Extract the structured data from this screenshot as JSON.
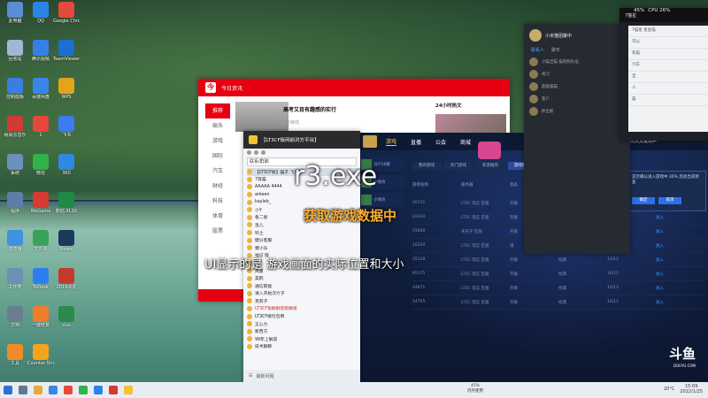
{
  "desktop": {
    "icons": [
      {
        "label": "此电脑",
        "color": "#5b8cd6"
      },
      {
        "label": "QQ",
        "color": "#2a84e8"
      },
      {
        "label": "Google Chrome",
        "color": "#e64a3c"
      },
      {
        "label": "回收站",
        "color": "#9fb7d8"
      },
      {
        "label": "腾讯视频",
        "color": "#3580e8"
      },
      {
        "label": "TeamViewer",
        "color": "#1c6fd1"
      },
      {
        "label": "控制面板",
        "color": "#3b7de0"
      },
      {
        "label": "百度网盘",
        "color": "#3a86e8"
      },
      {
        "label": "WPS",
        "color": "#e5a319"
      },
      {
        "label": "网易云音乐",
        "color": "#d33a31"
      },
      {
        "label": "1",
        "color": "#e8463a"
      },
      {
        "label": "飞书",
        "color": "#3c7bf0"
      },
      {
        "label": "系统",
        "color": "#6c90bc"
      },
      {
        "label": "微信",
        "color": "#2fb34a"
      },
      {
        "label": "360",
        "color": "#2d89e2"
      },
      {
        "label": "程序",
        "color": "#5d7fa6"
      },
      {
        "label": "WeGame",
        "color": "#d73a2f"
      },
      {
        "label": "数据.XLSX",
        "color": "#1f8a47"
      },
      {
        "label": "浏览器",
        "color": "#3f92e0"
      },
      {
        "label": "文件夹",
        "color": "#38a25a"
      },
      {
        "label": "Steam",
        "color": "#1b3a5c"
      },
      {
        "label": "工作表",
        "color": "#6d8fb3"
      },
      {
        "label": "ToDesk",
        "color": "#2c7ff0"
      },
      {
        "label": "2019录屏",
        "color": "#c53a2c"
      },
      {
        "label": "文档",
        "color": "#6b7d93"
      },
      {
        "label": "一键修复",
        "color": "#ef7d2a"
      },
      {
        "label": "xlsx",
        "color": "#2c8a4c"
      },
      {
        "label": "工具",
        "color": "#f08b2c"
      },
      {
        "label": "Counter-Strike Global Offensive",
        "color": "#f4a51c"
      }
    ]
  },
  "news": {
    "title": "今日资讯",
    "side": [
      "推荐",
      "娱乐",
      "游戏",
      "国际",
      "汽车",
      "财经",
      "科技",
      "体育",
      "股票"
    ],
    "item_title": "高考又目有趣感的实行",
    "item_sub": "7分钟前",
    "right_title": "24小时热文",
    "bottom_text": "你"
  },
  "chat": {
    "title": "【LT3CF板网前对方平台】",
    "search": "联系/群聊",
    "rows": [
      {
        "name": "【LT3CF板】猫子 飞?台",
        "group": false
      },
      {
        "name": "7等猫",
        "group": false
      },
      {
        "name": "AAAAA 4444",
        "group": false
      },
      {
        "name": "arkeen",
        "group": false
      },
      {
        "name": "kayleb_",
        "group": false
      },
      {
        "name": "小Y",
        "group": false
      },
      {
        "name": "各二星",
        "group": false
      },
      {
        "name": "洛儿",
        "group": false
      },
      {
        "name": "钎土",
        "group": false
      },
      {
        "name": "键分客服",
        "group": false
      },
      {
        "name": "猪小乐",
        "group": false
      },
      {
        "name": "福记 版",
        "group": false
      },
      {
        "name": "宇",
        "group": false
      },
      {
        "name": "风紧",
        "group": false
      },
      {
        "name": "昊鹤",
        "group": false
      },
      {
        "name": "通信职能",
        "group": false
      },
      {
        "name": "请入开始次介子",
        "group": false
      },
      {
        "name": "克莉子",
        "group": false
      },
      {
        "name": "LT3CF板群群客服群组",
        "group": true
      },
      {
        "name": "LT3CF接社包用",
        "group": false
      },
      {
        "name": "正心力",
        "group": false
      },
      {
        "name": "新西方",
        "group": false
      },
      {
        "name": "99年上解说",
        "group": false
      },
      {
        "name": "技术群聊",
        "group": false
      }
    ],
    "footer": "最新问题"
  },
  "game": {
    "nav": [
      "游戏",
      "直播",
      "公会",
      "商城"
    ],
    "tabs": [
      "我的游戏",
      "热门游戏",
      "新游推荐",
      "游戏排行",
      "角色扮演",
      "动作射击",
      "单机大作"
    ],
    "headers": [
      "游戏名称",
      "服务器",
      "状态",
      "模式",
      "人数",
      "操作"
    ],
    "rows": [
      {
        "name": "20731",
        "server": "LT3C 电信 区服",
        "status": "开服",
        "mode": "经典",
        "count": "10/12",
        "op": "加入"
      },
      {
        "name": "22344",
        "server": "LT3C 电信 区服",
        "status": "开服",
        "mode": "经典",
        "count": "10/11",
        "op": "加入"
      },
      {
        "name": "15609",
        "server": "未名子 区服",
        "status": "开服",
        "mode": "经典",
        "count": "10/12",
        "op": "加入"
      },
      {
        "name": "16334",
        "server": "LT3C 电信 区服",
        "status": "满",
        "mode": "经典",
        "count": "10/11",
        "op": "加入"
      },
      {
        "name": "35118",
        "server": "LT3C 电信 区服",
        "status": "开服",
        "mode": "经典",
        "count": "12/12",
        "op": "加入"
      },
      {
        "name": "95175",
        "server": "LT3C 电信 区服",
        "status": "开服",
        "mode": "经典",
        "count": "10/12",
        "op": "加入"
      },
      {
        "name": "44871",
        "server": "LT3C 电信 区服",
        "status": "开服",
        "mode": "经典",
        "count": "10/12",
        "op": "加入"
      },
      {
        "name": "14705",
        "server": "LT3C 电信 区服",
        "status": "开服",
        "mode": "经典",
        "count": "10/12",
        "op": "加入"
      }
    ],
    "left_items": [
      "30716服",
      "小地块",
      "小地块"
    ],
    "sale_text": "大大大发水声",
    "dialog_text": "是否确认进入游戏中 30% 后退出或修复",
    "dialog_ok": "确定",
    "dialog_cancel": "取消",
    "watermark": "斗鱼",
    "watermark_sub": "DOUYU.COM"
  },
  "captions": {
    "exe": "r3.exe",
    "data": "获取游戏数据中",
    "sub": "UI显示的是 游戏画面的实际位置和大小"
  },
  "mini_panel": {
    "name": "小米猫团聚中",
    "tabs": [
      "联系人",
      "聊天"
    ],
    "rows": [
      "小猫旦猫 猫狗狗队伍",
      "奇刀",
      "超级猫猫",
      "客户",
      "胖出新"
    ]
  },
  "mini_panel2": {
    "title": "7猫星",
    "rows": [
      "7猫星 星星猫",
      "可以",
      "有猫",
      "汽车",
      "旦",
      "人",
      "猫"
    ]
  },
  "perf": {
    "cpu_pct": "45%",
    "cpu_label": "CPU 26%"
  },
  "taskbar": {
    "mid_pct": "45%",
    "mid_label": "内存使用",
    "temp": "20°C",
    "time": "15:09",
    "date": "2022/1/25"
  }
}
